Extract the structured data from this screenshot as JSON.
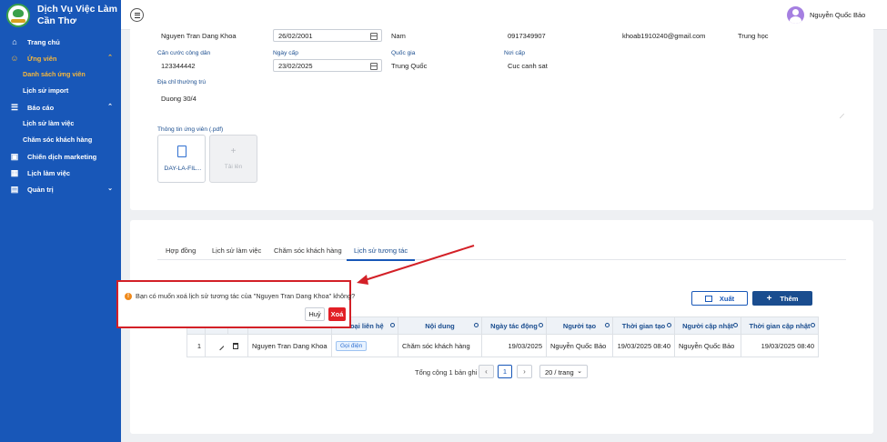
{
  "brand": {
    "line1": "Dịch Vụ Việc Làm",
    "line2": "Cần Thơ"
  },
  "sidebar": {
    "items": [
      {
        "label": "Trang chủ",
        "icon": "home-icon"
      },
      {
        "label": "Ứng viên",
        "icon": "user-icon"
      },
      {
        "label": "Danh sách ứng viên"
      },
      {
        "label": "Lịch sử import"
      },
      {
        "label": "Báo cáo",
        "icon": "list-icon"
      },
      {
        "label": "Lịch sử làm việc"
      },
      {
        "label": "Chăm sóc khách hàng"
      },
      {
        "label": "Chiến dịch marketing",
        "icon": "campaign-icon"
      },
      {
        "label": "Lịch làm việc",
        "icon": "calendar-icon"
      },
      {
        "label": "Quản trị",
        "icon": "admin-icon"
      }
    ]
  },
  "header": {
    "username": "Nguyễn Quốc Bảo"
  },
  "profile": {
    "name": "Nguyen Tran Dang Khoa",
    "dob": "26/02/2001",
    "gender": "Nam",
    "phone": "0917349907",
    "email": "khoab1910240@gmail.com",
    "education": "Trung học",
    "id_label": "Căn cước công dân",
    "id_value": "123344442",
    "issue_date_label": "Ngày cấp",
    "issue_date": "23/02/2025",
    "nationality_label": "Quốc gia",
    "nationality": "Trung Quốc",
    "issue_place_label": "Nơi cấp",
    "issue_place": "Cuc canh sat",
    "address_label": "Địa chỉ thường trú",
    "address": "Duong 30/4",
    "file_section_label": "Thông tin ứng viên (.pdf)",
    "file_name": "DAY-LA-FIL...",
    "upload_label": "Tải lên"
  },
  "tabs": [
    "Hợp đồng",
    "Lịch sử làm việc",
    "Chăm sóc khách hàng",
    "Lịch sử tương tác"
  ],
  "actions": {
    "export": "Xuất",
    "add": "Thêm"
  },
  "table": {
    "headers": [
      "",
      "",
      "",
      "",
      "Loại liên hệ",
      "Nội dung",
      "Ngày tác động",
      "Người tạo",
      "Thời gian tạo",
      "Người cập nhật",
      "Thời gian cập nhật"
    ],
    "row": {
      "index": "1",
      "name": "Nguyen Tran Dang Khoa",
      "contact_type": "Gọi điện",
      "content": "Chăm sóc khách hàng",
      "action_date": "19/03/2025",
      "creator": "Nguyễn Quốc Bảo",
      "created_at": "19/03/2025 08:40",
      "updater": "Nguyễn Quốc Bảo",
      "updated_at": "19/03/2025 08:40"
    }
  },
  "pagination": {
    "total": "Tổng cộng 1 bản ghi",
    "page": "1",
    "page_size": "20 / trang"
  },
  "popover": {
    "message": "Bạn có muốn xoá lịch sử tương tác của \"Nguyen Tran Dang Khoa\" không?",
    "cancel": "Huỷ",
    "delete": "Xoá"
  },
  "colors": {
    "sidebar": "#1857b8",
    "accent": "#1a4d8f",
    "danger": "#e21f26",
    "active_menu": "#f6b73c",
    "annotation": "#d32027"
  }
}
